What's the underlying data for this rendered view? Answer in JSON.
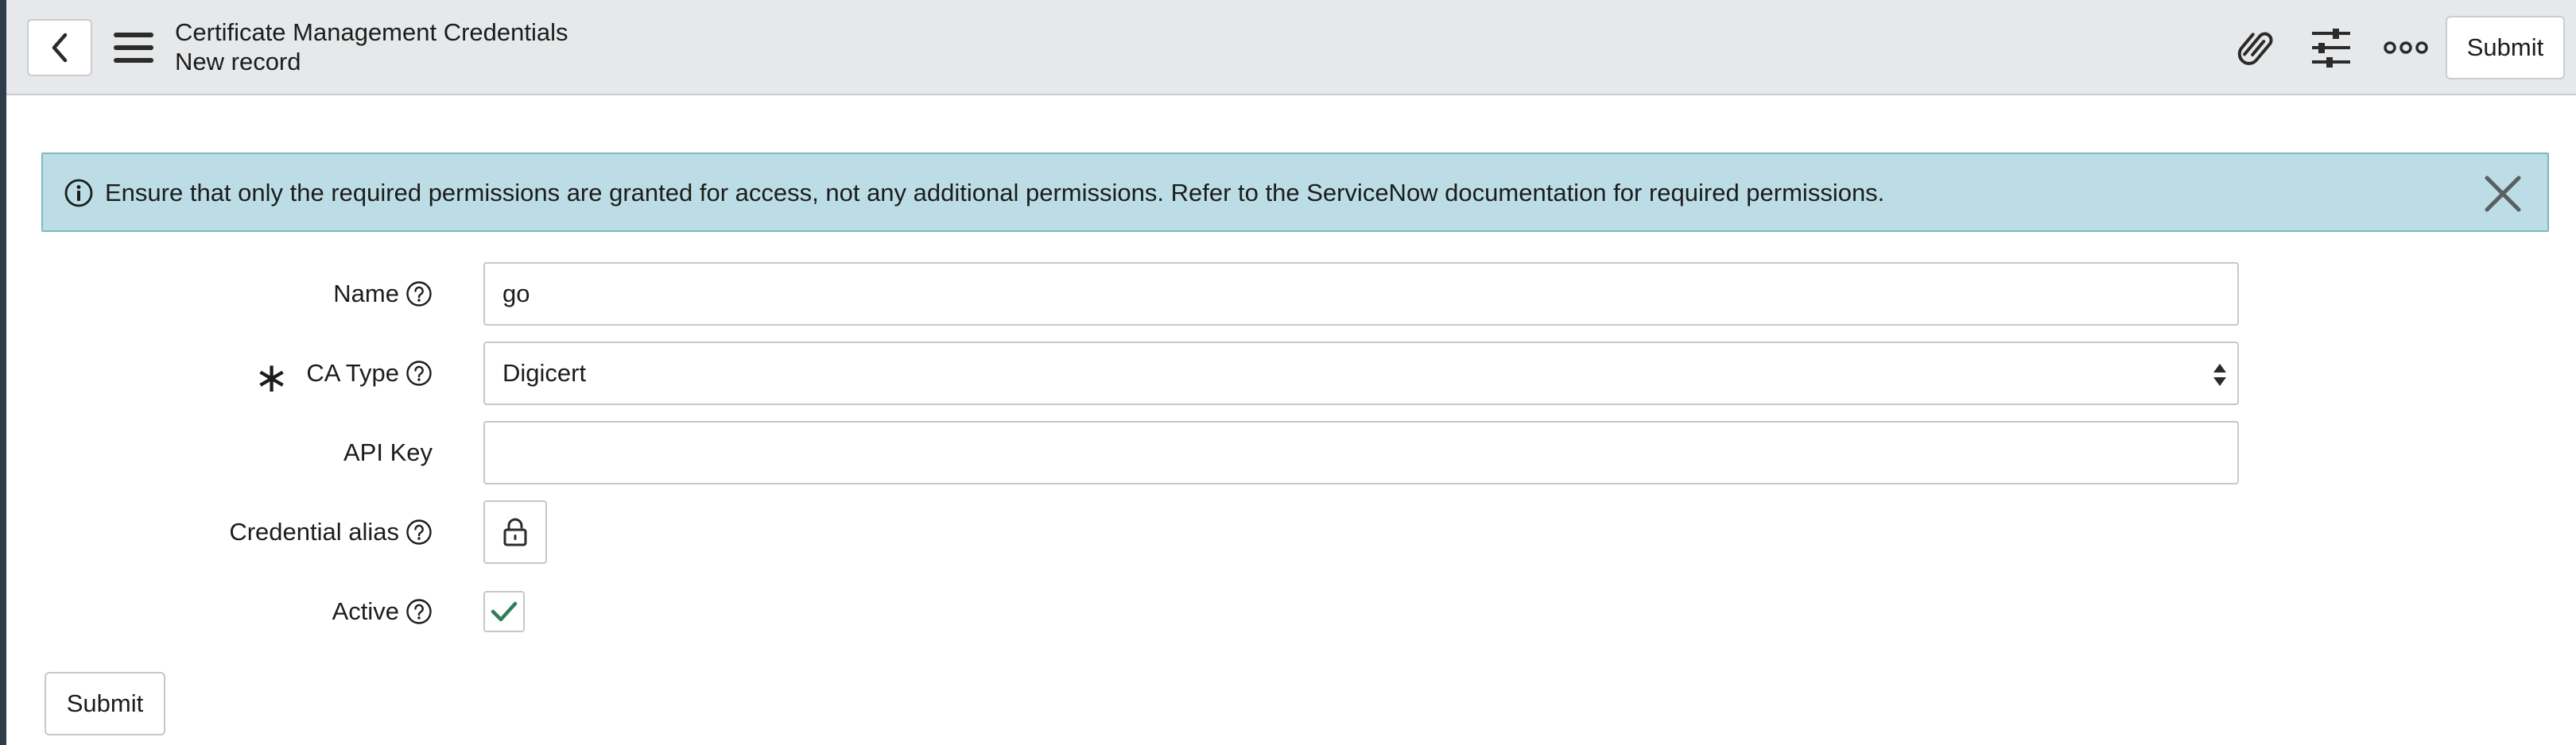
{
  "header": {
    "title": "Certificate Management Credentials",
    "subtitle": "New record",
    "back_icon": "chevron-left-icon",
    "menu_icon": "hamburger-icon",
    "attachment_icon": "paperclip-icon",
    "settings_icon": "sliders-icon",
    "more_icon": "more-icon",
    "submit_label": "Submit"
  },
  "banner": {
    "icon": "info-icon",
    "message": "Ensure that only the required permissions are granted for access, not any additional permissions. Refer to the ServiceNow documentation for required permissions.",
    "close_icon": "close-icon",
    "background": "#bcdde5"
  },
  "form": {
    "name": {
      "label": "Name",
      "value": "go",
      "has_help": true
    },
    "ca_type": {
      "label": "CA Type",
      "value": "Digicert",
      "required": true,
      "required_marker": "∗",
      "has_help": true
    },
    "api_key": {
      "label": "API Key",
      "value": ""
    },
    "credential_alias": {
      "label": "Credential alias",
      "has_help": true,
      "icon": "lock-icon"
    },
    "active": {
      "label": "Active",
      "checked": true,
      "has_help": true,
      "check_color": "#2e7d5b"
    }
  },
  "footer": {
    "submit_label": "Submit"
  }
}
